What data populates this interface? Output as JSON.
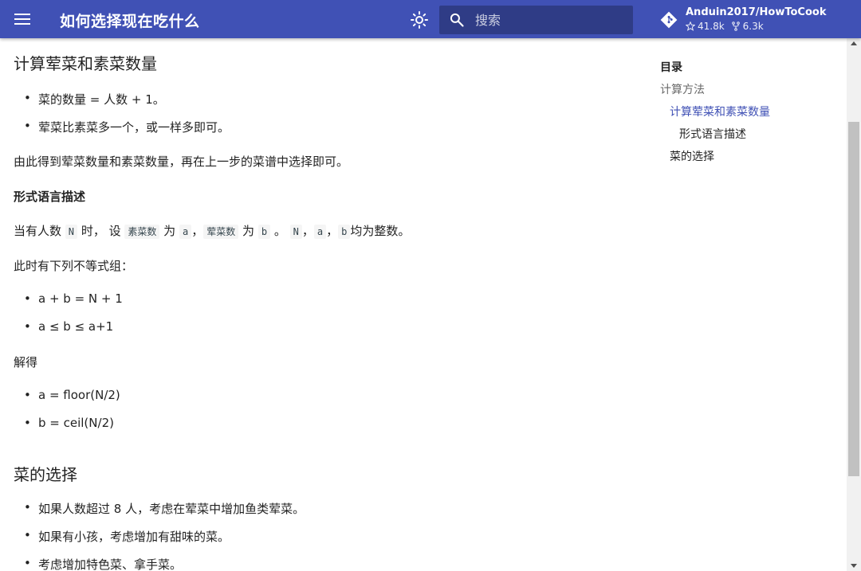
{
  "header": {
    "title": "如何选择现在吃什么",
    "search_placeholder": "搜索",
    "repo_name": "Anduin2017/HowToCook",
    "stars": "41.8k",
    "forks": "6.3k",
    "accent": "#4051b5"
  },
  "content": {
    "h_count": "计算荤菜和素菜数量",
    "count_items": [
      "菜的数量 = 人数 + 1。",
      "荤菜比素菜多一个，或一样多即可。"
    ],
    "count_para": "由此得到荤菜数量和素菜数量，再在上一步的菜谱中选择即可。",
    "h_formal": "形式语言描述",
    "formal_line": {
      "t1": "当有人数",
      "c_n": "N",
      "t2": "时， 设",
      "c_veg": "素菜数",
      "t3": "为",
      "c_a": "a",
      "t4": "，",
      "c_meat": "荤菜数",
      "t5": "为",
      "c_b": "b",
      "t6": "。",
      "c_n2": "N",
      "t7": "，",
      "c_a2": "a",
      "t8": "，",
      "c_b2": "b",
      "t9": "均为整数。"
    },
    "ineq_intro": "此时有下列不等式组：",
    "ineq_items": [
      "a + b = N + 1",
      "a ≤ b ≤ a+1"
    ],
    "solve": "解得",
    "solve_items": [
      "a = floor(N/2)",
      "b = ceil(N/2)"
    ],
    "h_choice": "菜的选择",
    "choice_items": [
      "如果人数超过 8 人，考虑在荤菜中增加鱼类荤菜。",
      "如果有小孩，考虑增加有甜味的菜。",
      "考虑增加特色菜、拿手菜。"
    ]
  },
  "toc": {
    "title": "目录",
    "items": [
      "计算方法",
      "计算荤菜和素菜数量",
      "形式语言描述",
      "菜的选择"
    ]
  }
}
